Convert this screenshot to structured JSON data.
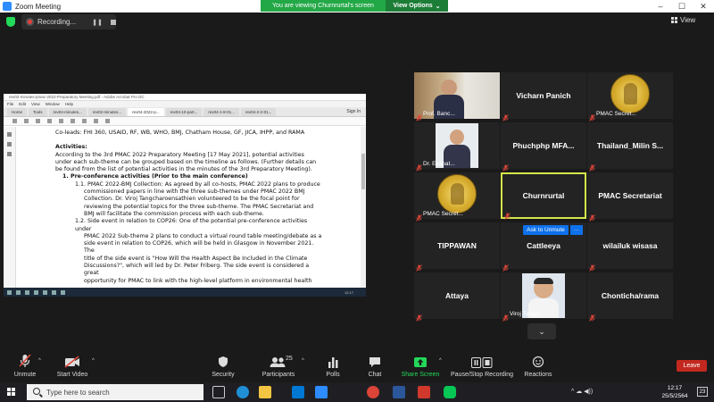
{
  "window": {
    "title": "Zoom Meeting",
    "min": "–",
    "max": "☐",
    "close": "✕"
  },
  "banner": {
    "viewing": "You are viewing Churnrurtal's screen",
    "view_options": "View Options",
    "caret": "⌄"
  },
  "topbar": {
    "recording": "Recording...",
    "pause": "❚❚",
    "view": "View"
  },
  "shared": {
    "pdf_title": "rev02-minutes-pmac-2022-Preparatory Meeting.pdf - Adobe Acrobat Pro DC",
    "menu": [
      "File",
      "Edit",
      "View",
      "Window",
      "Help"
    ],
    "nav": [
      "Home",
      "Tools"
    ],
    "tabs": [
      "rev04-minutes...",
      "rev02-minutes...",
      "rev04-2022-p...",
      "rev04-10-part...",
      "rev04-1-8-01...",
      "rev04-2-2-01..."
    ],
    "sign_in": "Sign In",
    "lines": [
      "Co-leads: FHI 360, USAID, RF, WB, WHO, BMJ, Chatham House, GF, JICA, IHPP, and RAMA",
      "Activities:",
      "According to the 3rd PMAC 2022 Preparatory Meeting [17 May 2021], potential activities",
      "under each sub-theme can be grouped based on the timeline as follows. (Further details can",
      "be found from the list of potential activities in the minutes of the 3rd Preparatory Meeting).",
      "1.   Pre-conference activities (Prior to the main conference)",
      "1.1. PMAC 2022-BMJ Collection: As agreed by all co-hosts, PMAC 2022 plans to produce",
      "commissioned papers in line with the three sub-themes under PMAC 2022 BMJ",
      "Collection. Dr. Viroj Tangcharoensathien volunteered to be the focal point for",
      "reviewing the potential topics for the three sub-theme. The PMAC Secretariat and",
      "BMJ will facilitate the commission process with each sub-theme.",
      "1.2. Side event in relation to COP26: One of the potential pre-conference activities under",
      "PMAC 2022 Sub-theme 2 plans to conduct a virtual round table meeting/debate as a",
      "side event in relation to COP26, which will be held in Glasgow in November 2021. The",
      "title of the side event is \"How Will the Health Aspect Be Included in the Climate",
      "Discussions?\", which will led by Dr. Peter Friberg. The side event is considered a great",
      "opportunity for PMAC to link with the high-level platform in environmental health"
    ],
    "taskbar_time": "12:17"
  },
  "participants": [
    {
      "name": "Prof. Banc...",
      "kind": "video",
      "muted": true
    },
    {
      "name": "Vicharn Panich",
      "kind": "text",
      "muted": true
    },
    {
      "name": "PMAC Secret...",
      "kind": "seal",
      "muted": true
    },
    {
      "name": "Dr. Ekapat...",
      "kind": "video",
      "muted": true
    },
    {
      "name": "Phuchphp  MFA...",
      "kind": "text",
      "muted": true
    },
    {
      "name": "Thailand_Milin  S...",
      "kind": "text",
      "muted": true
    },
    {
      "name": "PMAC Secret...",
      "kind": "seal",
      "muted": true
    },
    {
      "name": "Churnrurtal",
      "kind": "text",
      "muted": true,
      "active": true
    },
    {
      "name": "PMAC Secretariat",
      "kind": "text",
      "muted": true
    },
    {
      "name": "TIPPAWAN",
      "kind": "text",
      "muted": true
    },
    {
      "name": "Cattleeya",
      "kind": "text",
      "muted": true
    },
    {
      "name": "wilailuk wisasa",
      "kind": "text",
      "muted": true
    },
    {
      "name": "Attaya",
      "kind": "text",
      "muted": true
    },
    {
      "name": "Viroj Tangch...",
      "kind": "video",
      "muted": true
    },
    {
      "name": "Chonticha/rama",
      "kind": "text",
      "muted": true
    }
  ],
  "ask_unmute": "Ask to Unmute",
  "ask_more": "···",
  "page_down": "⌄",
  "toolbar": {
    "unmute": "Unmute",
    "start_video": "Start Video",
    "security": "Security",
    "participants": "Participants",
    "participants_count": "25",
    "polls": "Polls",
    "chat": "Chat",
    "share_screen": "Share Screen",
    "pause_stop_recording": "Pause/Stop Recording",
    "reactions": "Reactions",
    "leave": "Leave"
  },
  "taskbar": {
    "search_placeholder": "Type here to search",
    "time": "12:17",
    "date": "25/5/2564",
    "notifications": "23",
    "tray": "^ ☁ ◀))"
  },
  "colors": {
    "accent": "#0e71eb",
    "share_green": "#23d959",
    "leave_red": "#c2281e",
    "active_speaker": "#d6e64a",
    "mute_red": "#e0463a"
  }
}
